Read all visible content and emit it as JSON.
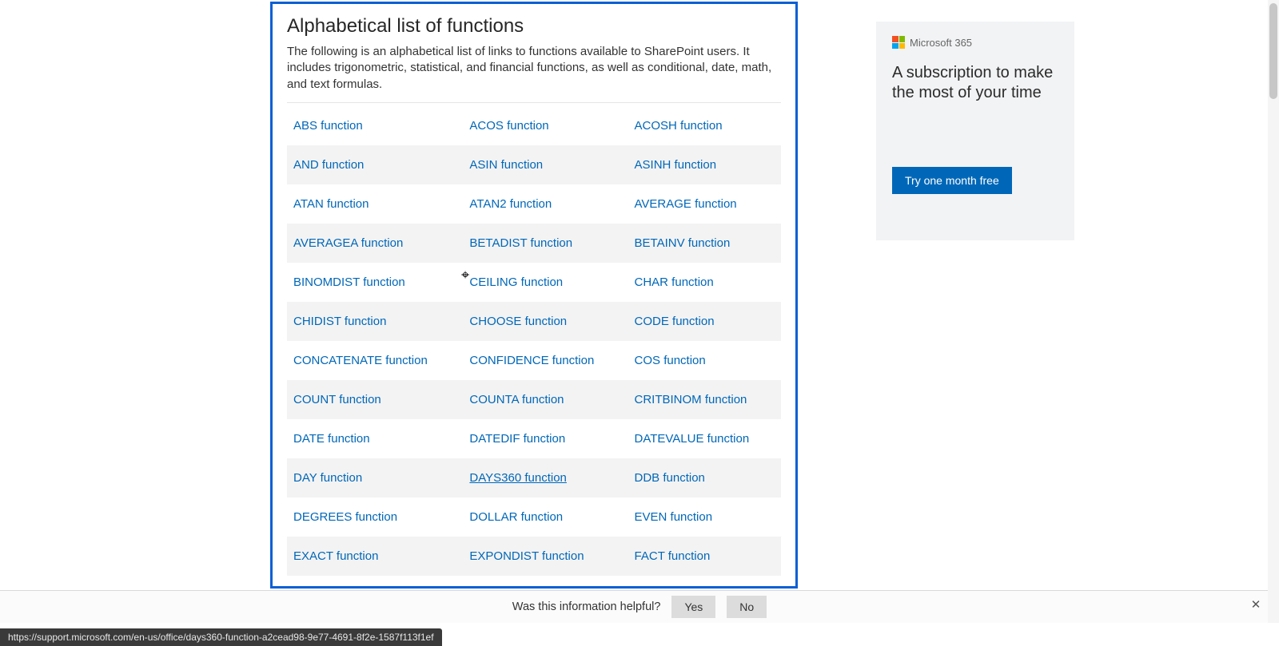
{
  "article": {
    "title": "Alphabetical list of functions",
    "description": "The following is an alphabetical list of links to functions available to SharePoint users. It includes trigonometric, statistical, and financial functions, as well as conditional, date, math, and text formulas.",
    "rows": [
      [
        "ABS function",
        "ACOS function",
        "ACOSH function"
      ],
      [
        "AND function",
        "ASIN function",
        "ASINH function"
      ],
      [
        "ATAN function",
        "ATAN2 function",
        "AVERAGE function"
      ],
      [
        "AVERAGEA function",
        "BETADIST function",
        "BETAINV function"
      ],
      [
        "BINOMDIST function",
        "CEILING function",
        "CHAR function"
      ],
      [
        "CHIDIST function",
        "CHOOSE function",
        "CODE function"
      ],
      [
        "CONCATENATE function",
        "CONFIDENCE function",
        "COS function"
      ],
      [
        "COUNT function",
        "COUNTA function",
        "CRITBINOM function"
      ],
      [
        "DATE function",
        "DATEDIF function",
        "DATEVALUE function"
      ],
      [
        "DAY function",
        "DAYS360 function",
        "DDB function"
      ],
      [
        "DEGREES function",
        "DOLLAR function",
        "EVEN function"
      ],
      [
        "EXACT function",
        "EXPONDIST function",
        "FACT function"
      ]
    ],
    "underlined_cell": "9.1"
  },
  "promo": {
    "brand": "Microsoft 365",
    "headline": "A subscription to make the most of your time",
    "cta": "Try one month free"
  },
  "feedback": {
    "prompt": "Was this information helpful?",
    "yes": "Yes",
    "no": "No"
  },
  "status_url": "https://support.microsoft.com/en-us/office/days360-function-a2cead98-9e77-4691-8f2e-1587f113f1ef"
}
